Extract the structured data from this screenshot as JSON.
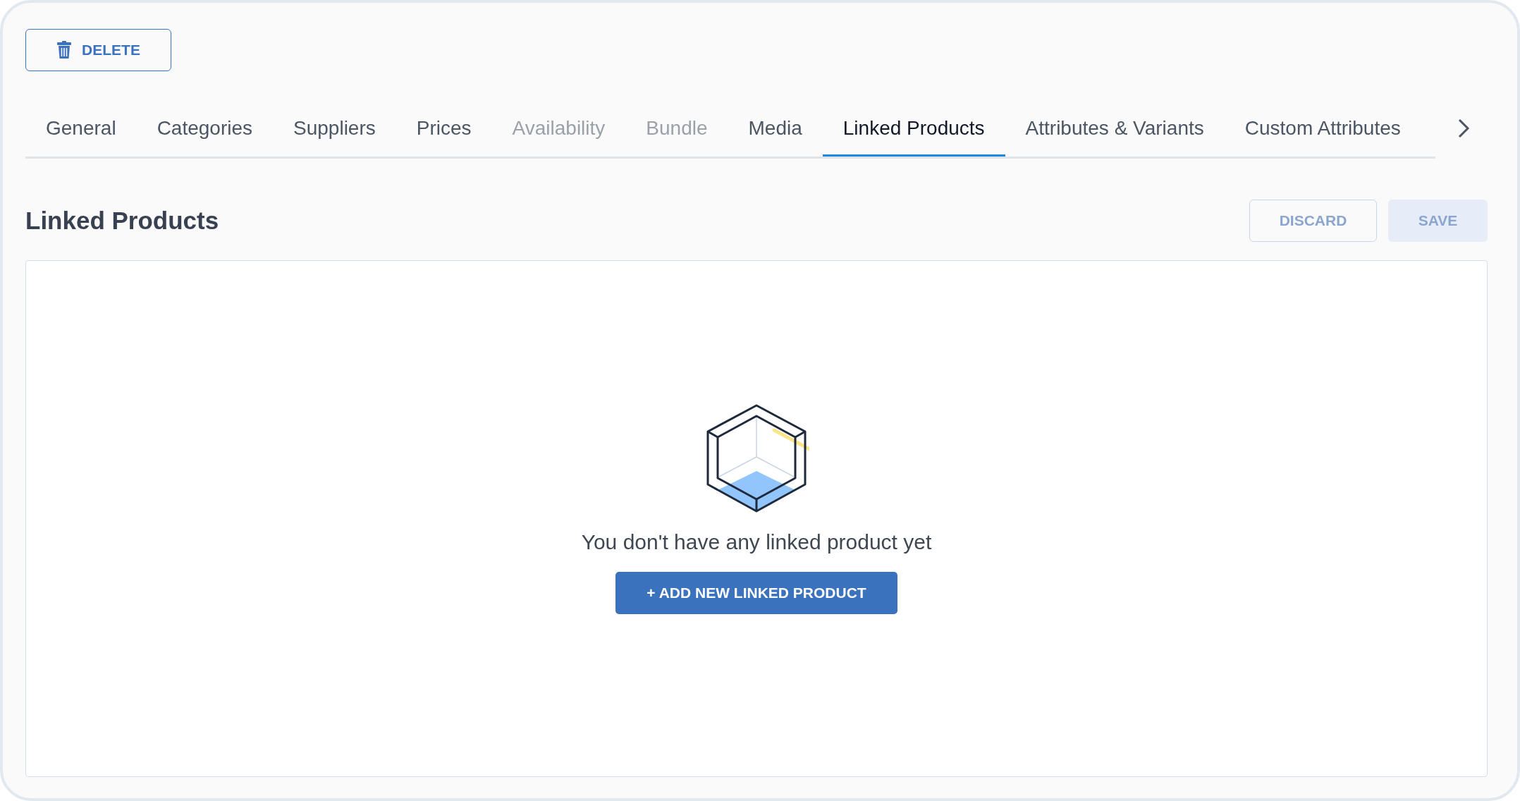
{
  "toolbar": {
    "delete_button": {
      "label": "DELETE"
    }
  },
  "tabs": [
    {
      "label": "General",
      "selected": false,
      "disabled": false
    },
    {
      "label": "Categories",
      "selected": false,
      "disabled": false
    },
    {
      "label": "Suppliers",
      "selected": false,
      "disabled": false
    },
    {
      "label": "Prices",
      "selected": false,
      "disabled": false
    },
    {
      "label": "Availability",
      "selected": false,
      "disabled": true
    },
    {
      "label": "Bundle",
      "selected": false,
      "disabled": true
    },
    {
      "label": "Media",
      "selected": false,
      "disabled": false
    },
    {
      "label": "Linked Products",
      "selected": true,
      "disabled": false
    },
    {
      "label": "Attributes & Variants",
      "selected": false,
      "disabled": false
    },
    {
      "label": "Custom Attributes",
      "selected": false,
      "disabled": false
    }
  ],
  "section": {
    "title": "Linked Products",
    "actions": [
      {
        "label": "DISCARD",
        "kind": "outline",
        "disabled": true
      },
      {
        "label": "SAVE",
        "kind": "filled",
        "disabled": true
      }
    ]
  },
  "empty_state": {
    "message": "You don't have any linked product yet",
    "button": "+ ADD NEW LINKED PRODUCT"
  }
}
